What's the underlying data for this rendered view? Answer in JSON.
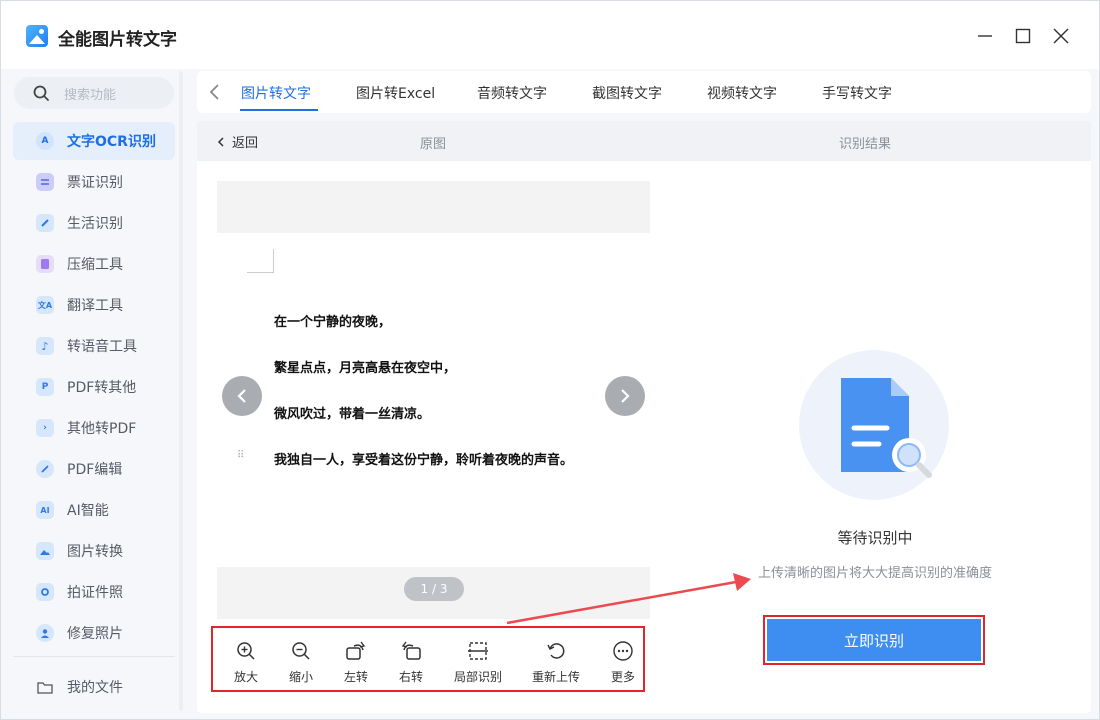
{
  "app": {
    "title": "全能图片转文字"
  },
  "sidebar": {
    "search_placeholder": "搜索功能",
    "items": [
      {
        "label": "文字OCR识别",
        "icon": "ocr-icon",
        "color": "#3d8ef0",
        "active": true
      },
      {
        "label": "票证识别",
        "icon": "ticket-icon",
        "color": "#6c7ef0"
      },
      {
        "label": "生活识别",
        "icon": "pen-icon",
        "color": "#3d8ef0"
      },
      {
        "label": "压缩工具",
        "icon": "compress-icon",
        "color": "#9c7cf0"
      },
      {
        "label": "翻译工具",
        "icon": "translate-icon",
        "color": "#3d8ef0"
      },
      {
        "label": "转语音工具",
        "icon": "music-icon",
        "color": "#3d8ef0"
      },
      {
        "label": "PDF转其他",
        "icon": "pdf-icon",
        "color": "#3d8ef0"
      },
      {
        "label": "其他转PDF",
        "icon": "to-pdf-icon",
        "color": "#3d8ef0"
      },
      {
        "label": "PDF编辑",
        "icon": "edit-icon",
        "color": "#3d8ef0"
      },
      {
        "label": "AI智能",
        "icon": "ai-icon",
        "color": "#3d8ef0"
      },
      {
        "label": "图片转换",
        "icon": "image-icon",
        "color": "#3d8ef0"
      },
      {
        "label": "拍证件照",
        "icon": "camera-icon",
        "color": "#3d8ef0"
      },
      {
        "label": "修复照片",
        "icon": "person-icon",
        "color": "#3d8ef0"
      }
    ],
    "files_label": "我的文件"
  },
  "tabs": [
    {
      "label": "图片转文字",
      "active": true
    },
    {
      "label": "图片转Excel"
    },
    {
      "label": "音频转文字"
    },
    {
      "label": "截图转文字"
    },
    {
      "label": "视频转文字"
    },
    {
      "label": "手写转文字"
    }
  ],
  "subheader": {
    "back_label": "返回",
    "original_label": "原图",
    "result_label": "识别结果"
  },
  "preview": {
    "lines": [
      "在一个宁静的夜晚，",
      "繁星点点，月亮高悬在夜空中，",
      "微风吹过，带着一丝清凉。",
      "我独自一人，享受着这份宁静，聆听着夜晚的声音。"
    ],
    "page_indicator": "1 / 3"
  },
  "toolbar": [
    {
      "label": "放大",
      "icon": "zoom-in-icon"
    },
    {
      "label": "缩小",
      "icon": "zoom-out-icon"
    },
    {
      "label": "左转",
      "icon": "rotate-left-icon"
    },
    {
      "label": "右转",
      "icon": "rotate-right-icon"
    },
    {
      "label": "局部识别",
      "icon": "crop-icon"
    },
    {
      "label": "重新上传",
      "icon": "reupload-icon"
    },
    {
      "label": "更多",
      "icon": "more-icon"
    }
  ],
  "result": {
    "status": "等待识别中",
    "hint": "上传清晰的图片将大大提高识别的准确度",
    "button_label": "立即识别"
  },
  "colors": {
    "accent": "#1e6fe6",
    "button": "#3d8ef0",
    "highlight_border": "#e0262c"
  }
}
